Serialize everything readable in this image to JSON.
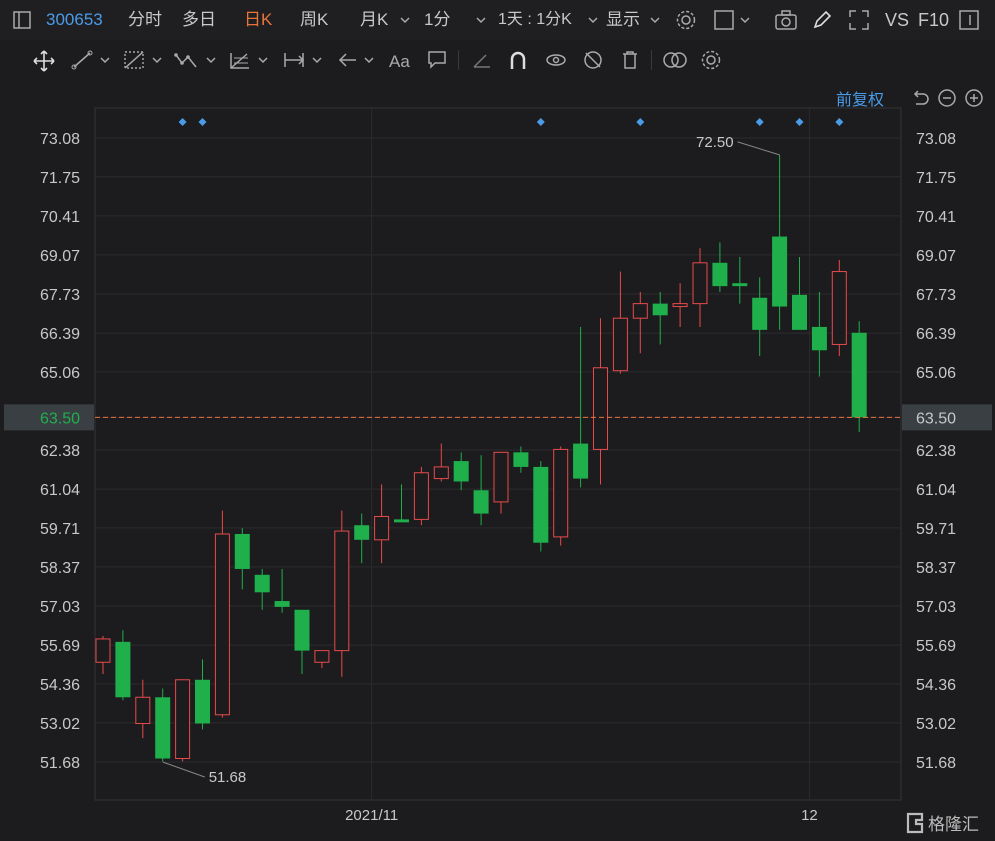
{
  "toolbar": {
    "stock_code": "300653",
    "tabs": [
      "分时",
      "多日",
      "日K",
      "周K",
      "月K",
      "1分"
    ],
    "active_tab": "日K",
    "multi_period": "1天 : 1分K",
    "display": "显示",
    "vs_label": "VS",
    "f10_label": "F10"
  },
  "price_adjust": "前复权",
  "colors": {
    "up": "#e84a4a",
    "down": "#1fb04c",
    "last_price_line": "#e8743b",
    "accent": "#4a9be8"
  },
  "watermark": "格隆汇",
  "chart_data": {
    "type": "candlestick",
    "y_ticks": [
      73.08,
      71.75,
      70.41,
      69.07,
      67.73,
      66.39,
      65.06,
      63.5,
      62.38,
      61.04,
      59.71,
      58.37,
      57.03,
      55.69,
      54.36,
      53.02,
      51.68
    ],
    "ylim": [
      51.0,
      73.6
    ],
    "x_labels": [
      {
        "label": "2021/11",
        "index": 13.5
      },
      {
        "label": "12",
        "index": 35.5
      }
    ],
    "last_price": 63.5,
    "annotations": [
      {
        "label": "72.50",
        "index": 34,
        "value": 72.5
      },
      {
        "label": "51.68",
        "index": 3,
        "value": 51.68
      }
    ],
    "event_markers": [
      4,
      5,
      22,
      27,
      33,
      35,
      37
    ],
    "candles": [
      {
        "o": 55.1,
        "h": 56.0,
        "l": 54.7,
        "c": 55.9
      },
      {
        "o": 55.8,
        "h": 56.2,
        "l": 53.8,
        "c": 53.9
      },
      {
        "o": 53.0,
        "h": 54.5,
        "l": 52.5,
        "c": 53.9
      },
      {
        "o": 53.9,
        "h": 54.2,
        "l": 51.7,
        "c": 51.8
      },
      {
        "o": 51.8,
        "h": 54.5,
        "l": 51.7,
        "c": 54.5
      },
      {
        "o": 54.5,
        "h": 55.2,
        "l": 52.8,
        "c": 53.0
      },
      {
        "o": 53.3,
        "h": 60.3,
        "l": 53.2,
        "c": 59.5
      },
      {
        "o": 59.5,
        "h": 59.7,
        "l": 57.6,
        "c": 58.3
      },
      {
        "o": 58.1,
        "h": 58.3,
        "l": 56.9,
        "c": 57.5
      },
      {
        "o": 57.2,
        "h": 58.3,
        "l": 56.8,
        "c": 57.0
      },
      {
        "o": 56.9,
        "h": 56.9,
        "l": 54.7,
        "c": 55.5
      },
      {
        "o": 55.1,
        "h": 55.5,
        "l": 54.9,
        "c": 55.5
      },
      {
        "o": 55.5,
        "h": 60.3,
        "l": 54.6,
        "c": 59.6
      },
      {
        "o": 59.8,
        "h": 60.2,
        "l": 58.5,
        "c": 59.3
      },
      {
        "o": 59.3,
        "h": 61.2,
        "l": 58.5,
        "c": 60.1
      },
      {
        "o": 60.0,
        "h": 61.2,
        "l": 59.9,
        "c": 59.9
      },
      {
        "o": 60.0,
        "h": 61.8,
        "l": 59.8,
        "c": 61.6
      },
      {
        "o": 61.4,
        "h": 62.6,
        "l": 61.3,
        "c": 61.8
      },
      {
        "o": 62.0,
        "h": 62.3,
        "l": 61.0,
        "c": 61.3
      },
      {
        "o": 61.0,
        "h": 62.2,
        "l": 59.8,
        "c": 60.2
      },
      {
        "o": 60.6,
        "h": 62.3,
        "l": 60.2,
        "c": 62.3
      },
      {
        "o": 62.3,
        "h": 62.5,
        "l": 61.6,
        "c": 61.8
      },
      {
        "o": 61.8,
        "h": 62.0,
        "l": 58.9,
        "c": 59.2
      },
      {
        "o": 59.4,
        "h": 62.5,
        "l": 59.1,
        "c": 62.4
      },
      {
        "o": 62.6,
        "h": 66.6,
        "l": 61.1,
        "c": 61.4
      },
      {
        "o": 62.4,
        "h": 66.9,
        "l": 61.2,
        "c": 65.2
      },
      {
        "o": 65.1,
        "h": 68.5,
        "l": 65.0,
        "c": 66.9
      },
      {
        "o": 66.9,
        "h": 67.8,
        "l": 65.7,
        "c": 67.4
      },
      {
        "o": 67.4,
        "h": 67.8,
        "l": 66.0,
        "c": 67.0
      },
      {
        "o": 67.3,
        "h": 68.1,
        "l": 66.6,
        "c": 67.4
      },
      {
        "o": 67.4,
        "h": 69.3,
        "l": 66.6,
        "c": 68.8
      },
      {
        "o": 68.8,
        "h": 69.5,
        "l": 67.8,
        "c": 68.0
      },
      {
        "o": 68.1,
        "h": 69.0,
        "l": 67.4,
        "c": 68.0
      },
      {
        "o": 67.6,
        "h": 68.3,
        "l": 65.6,
        "c": 66.5
      },
      {
        "o": 69.7,
        "h": 72.5,
        "l": 66.5,
        "c": 67.3
      },
      {
        "o": 67.7,
        "h": 69.0,
        "l": 66.5,
        "c": 66.5
      },
      {
        "o": 66.6,
        "h": 67.8,
        "l": 64.9,
        "c": 65.8
      },
      {
        "o": 66.0,
        "h": 68.9,
        "l": 65.6,
        "c": 68.5
      },
      {
        "o": 66.4,
        "h": 66.8,
        "l": 63.0,
        "c": 63.5
      }
    ]
  }
}
